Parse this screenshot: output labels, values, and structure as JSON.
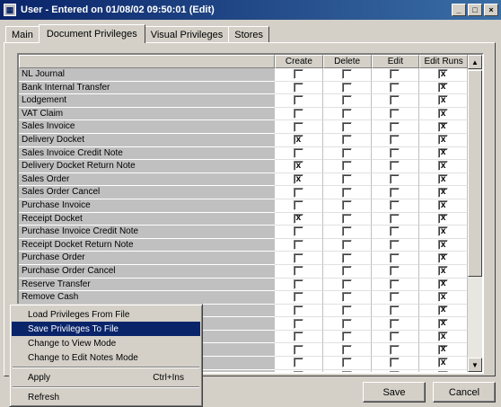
{
  "window": {
    "title": "User - Entered on 01/08/02 09:50:01 (Edit)",
    "icon": "window-app-icon",
    "buttons": [
      "_",
      "□",
      "×"
    ]
  },
  "tabs": [
    {
      "label": "Main"
    },
    {
      "label": "Document Privileges"
    },
    {
      "label": "Visual Privileges"
    },
    {
      "label": "Stores"
    }
  ],
  "grid": {
    "columns": [
      "Create",
      "Delete",
      "Edit",
      "Edit Runs"
    ],
    "rows": [
      {
        "name": "NL Journal",
        "c": [
          "",
          "",
          "",
          "x"
        ]
      },
      {
        "name": "Bank Internal Transfer",
        "c": [
          "",
          "",
          "",
          "x"
        ]
      },
      {
        "name": "Lodgement",
        "c": [
          "",
          "",
          "",
          "x"
        ]
      },
      {
        "name": "VAT Claim",
        "c": [
          "",
          "",
          "",
          "x"
        ]
      },
      {
        "name": "Sales Invoice",
        "c": [
          "",
          "",
          "",
          "x"
        ]
      },
      {
        "name": "Delivery Docket",
        "c": [
          "x",
          "",
          "",
          "x"
        ]
      },
      {
        "name": "Sales Invoice Credit Note",
        "c": [
          "",
          "",
          "",
          "x"
        ]
      },
      {
        "name": "Delivery Docket Return Note",
        "c": [
          "x",
          "",
          "",
          "x"
        ]
      },
      {
        "name": "Sales Order",
        "c": [
          "x",
          "",
          "",
          "x"
        ]
      },
      {
        "name": "Sales Order Cancel",
        "c": [
          "",
          "",
          "",
          "x"
        ]
      },
      {
        "name": "Purchase Invoice",
        "c": [
          "",
          "",
          "",
          "x"
        ]
      },
      {
        "name": "Receipt Docket",
        "c": [
          "x",
          "",
          "",
          "x"
        ]
      },
      {
        "name": "Purchase Invoice Credit Note",
        "c": [
          "",
          "",
          "",
          "x"
        ]
      },
      {
        "name": "Receipt Docket Return Note",
        "c": [
          "",
          "",
          "",
          "x"
        ]
      },
      {
        "name": "Purchase Order",
        "c": [
          "",
          "",
          "",
          "x"
        ]
      },
      {
        "name": "Purchase Order Cancel",
        "c": [
          "",
          "",
          "",
          "x"
        ]
      },
      {
        "name": "Reserve Transfer",
        "c": [
          "",
          "",
          "",
          "x"
        ]
      },
      {
        "name": "Remove Cash",
        "c": [
          "",
          "",
          "",
          "x"
        ]
      },
      {
        "name": "",
        "c": [
          "",
          "",
          "",
          "x"
        ]
      },
      {
        "name": "",
        "c": [
          "",
          "",
          "",
          "x"
        ]
      },
      {
        "name": "",
        "c": [
          "",
          "",
          "",
          "x"
        ]
      },
      {
        "name": "",
        "c": [
          "",
          "",
          "",
          "x"
        ]
      },
      {
        "name": "",
        "c": [
          "",
          "",
          "",
          "x"
        ]
      },
      {
        "name": "",
        "c": [
          "x",
          "",
          "",
          "x"
        ]
      }
    ]
  },
  "context_menu": {
    "items": [
      {
        "label": "Load Privileges From File",
        "shortcut": ""
      },
      {
        "label": "Save Privileges To File",
        "shortcut": "",
        "selected": true
      },
      {
        "label": "Change to View Mode",
        "shortcut": ""
      },
      {
        "label": "Change to Edit Notes Mode",
        "shortcut": ""
      },
      {
        "separator": true
      },
      {
        "label": "Apply",
        "shortcut": "Ctrl+Ins"
      },
      {
        "separator": true
      },
      {
        "label": "Refresh",
        "shortcut": ""
      }
    ]
  },
  "buttons": {
    "save_label": "Save",
    "cancel_label": "Cancel"
  },
  "scrollbar": {
    "up_arrow": "▲",
    "down_arrow": "▼"
  },
  "colors": {
    "titlebar": "#0a246a",
    "face": "#d4d0c8",
    "selection": "#0a246a"
  }
}
